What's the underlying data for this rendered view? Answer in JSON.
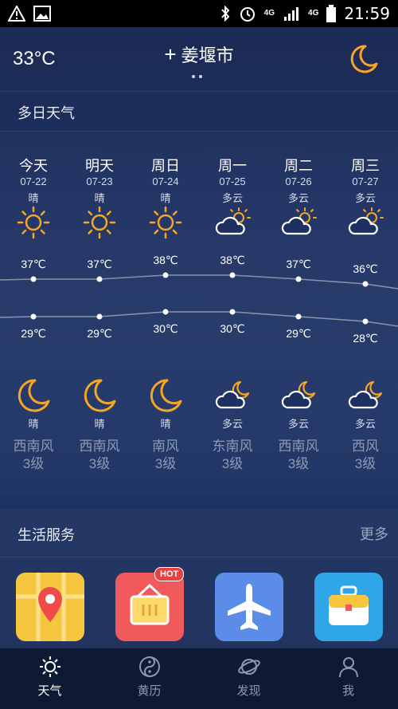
{
  "status_bar": {
    "network": "4G",
    "network2": "4G",
    "time": "21:59"
  },
  "header": {
    "current_temp": "33°C",
    "city_prefix": "+",
    "city": "姜堰市"
  },
  "sections": {
    "forecast_title": "多日天气",
    "services_title": "生活服务",
    "services_more": "更多"
  },
  "days": [
    {
      "name": "今天",
      "date": "07-22",
      "day_cond": "晴",
      "high": "37℃",
      "low": "29℃",
      "night_cond": "晴",
      "wind_dir": "西南风",
      "wind_level": "3级",
      "day_icon": "sun-icon",
      "night_icon": "moon-icon"
    },
    {
      "name": "明天",
      "date": "07-23",
      "day_cond": "晴",
      "high": "37℃",
      "low": "29℃",
      "night_cond": "晴",
      "wind_dir": "西南风",
      "wind_level": "3级",
      "day_icon": "sun-icon",
      "night_icon": "moon-icon"
    },
    {
      "name": "周日",
      "date": "07-24",
      "day_cond": "晴",
      "high": "38℃",
      "low": "30℃",
      "night_cond": "晴",
      "wind_dir": "南风",
      "wind_level": "3级",
      "day_icon": "sun-icon",
      "night_icon": "moon-icon"
    },
    {
      "name": "周一",
      "date": "07-25",
      "day_cond": "多云",
      "high": "38℃",
      "low": "30℃",
      "night_cond": "多云",
      "wind_dir": "东南风",
      "wind_level": "3级",
      "day_icon": "cloud-sun-icon",
      "night_icon": "cloud-moon-icon"
    },
    {
      "name": "周二",
      "date": "07-26",
      "day_cond": "多云",
      "high": "37℃",
      "low": "29℃",
      "night_cond": "多云",
      "wind_dir": "西南风",
      "wind_level": "3级",
      "day_icon": "cloud-sun-icon",
      "night_icon": "cloud-moon-icon"
    },
    {
      "name": "周三",
      "date": "07-27",
      "day_cond": "多云",
      "high": "36℃",
      "low": "28℃",
      "night_cond": "多云",
      "wind_dir": "西风",
      "wind_level": "3级",
      "day_icon": "cloud-sun-icon",
      "night_icon": "cloud-moon-icon"
    }
  ],
  "services": [
    {
      "icon": "map-pin-icon",
      "color": "#f7c63f"
    },
    {
      "icon": "basket-icon",
      "color": "#f05a5a",
      "badge": "HOT"
    },
    {
      "icon": "airplane-icon",
      "color": "#5b8de8"
    },
    {
      "icon": "suitcase-icon",
      "color": "#2fa6e8"
    }
  ],
  "nav": [
    {
      "label": "天气",
      "icon": "sun-icon",
      "active": true
    },
    {
      "label": "黄历",
      "icon": "yinyang-icon",
      "active": false
    },
    {
      "label": "发现",
      "icon": "planet-icon",
      "active": false
    },
    {
      "label": "我",
      "icon": "person-icon",
      "active": false
    }
  ],
  "colors": {
    "accent": "#f5a623",
    "background": "#1d3062",
    "nav_bg": "#0e1a33"
  }
}
